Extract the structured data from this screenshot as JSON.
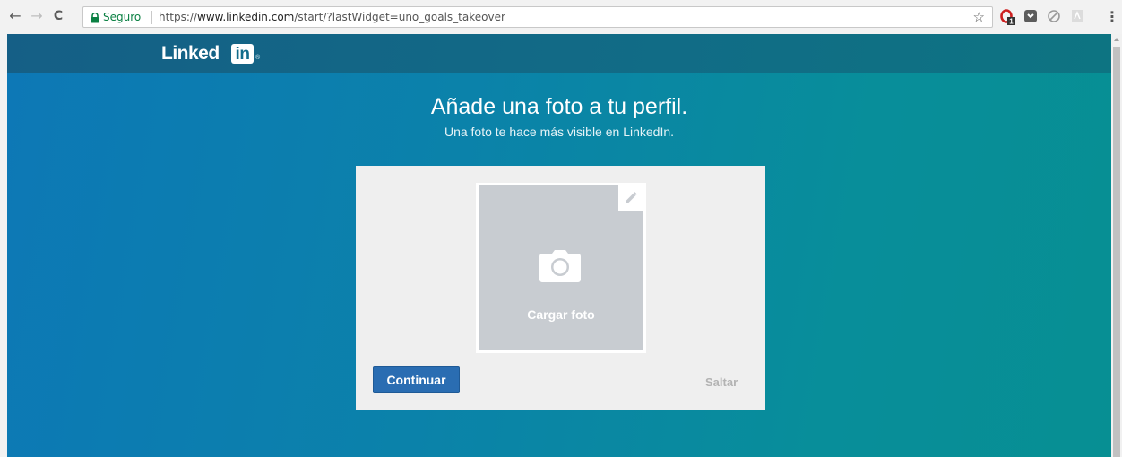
{
  "browser": {
    "back_glyph": "←",
    "forward_glyph": "→",
    "reload_glyph": "C",
    "secure_label": "Seguro",
    "url_prefix": "https://",
    "url_domain": "www.linkedin.com",
    "url_path": "/start/?lastWidget=uno_goals_takeover",
    "bookmark_glyph": "☆",
    "menu_glyph": "⋮",
    "extension_badge": "1"
  },
  "header": {
    "logo_word": "Linked",
    "logo_in": "in",
    "logo_reg": "®"
  },
  "main": {
    "title": "Añade una foto a tu perfil.",
    "subtitle": "Una foto te hace más visible en LinkedIn.",
    "upload_label": "Cargar foto",
    "continue_label": "Continuar",
    "skip_label": "Saltar"
  },
  "colors": {
    "brand_blue": "#2a6db2",
    "page_teal": "#0b82aa",
    "secure_green": "#0b8043"
  }
}
